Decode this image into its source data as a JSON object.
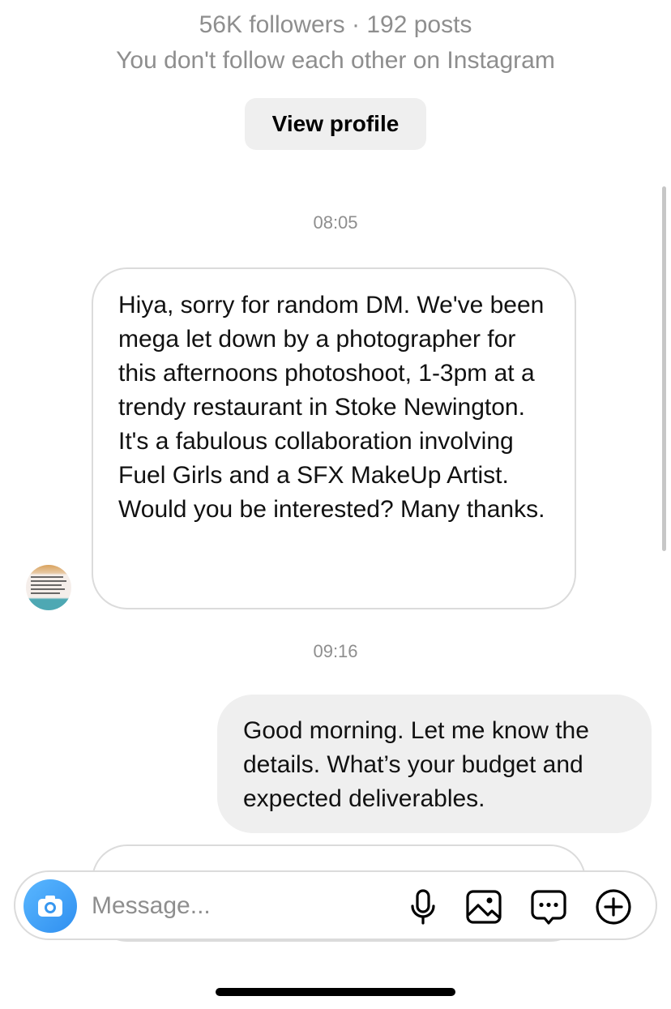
{
  "profile": {
    "followers_text": "56K followers · 192 posts",
    "mutual_text": "You don't follow each other on Instagram",
    "view_profile_label": "View profile"
  },
  "thread": {
    "messages": [
      {
        "time": "08:05"
      },
      {
        "text": "Hiya, sorry for random DM. We've been mega let down by a photographer for this afternoons photoshoot, 1-3pm at a trendy restaurant in Stoke Newington. It's a fabulous collaboration involving Fuel Girls and a SFX MakeUp Artist. Would you be interested? Many thanks."
      },
      {
        "time": "09:16"
      },
      {
        "text": "Good morning. Let me know the details. What’s your budget and expected deliverables."
      }
    ]
  },
  "composer": {
    "placeholder": "Message...",
    "icons": [
      "camera-icon",
      "microphone-icon",
      "gallery-icon",
      "sticker-icon",
      "plus-icon"
    ],
    "camera_color": "#3797f0"
  },
  "colors": {
    "secondary_text": "#8e8e8e",
    "incoming_border": "#dbdbdb",
    "outgoing_bg": "#efefef"
  }
}
